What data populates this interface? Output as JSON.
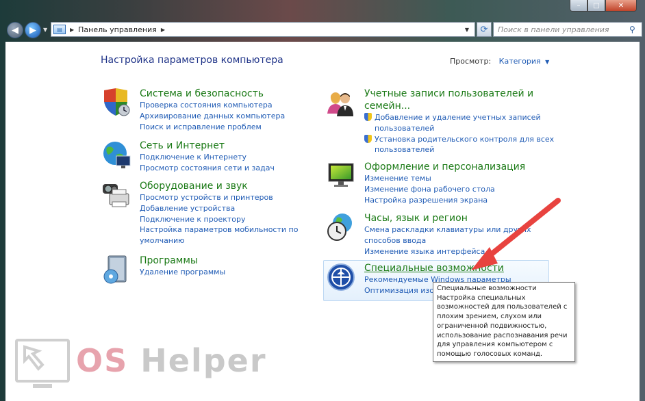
{
  "window": {
    "caption_buttons": [
      "–",
      "□",
      "✕"
    ]
  },
  "address_bar": {
    "path": "Панель управления"
  },
  "search": {
    "placeholder": "Поиск в панели управления"
  },
  "header": {
    "title": "Настройка параметров компьютера",
    "view_label": "Просмотр:",
    "view_value": "Категория"
  },
  "categories": [
    {
      "title": "Система и безопасность",
      "links": [
        "Проверка состояния компьютера",
        "Архивирование данных компьютера",
        "Поиск и исправление проблем"
      ]
    },
    {
      "title": "Сеть и Интернет",
      "links": [
        "Подключение к Интернету",
        "Просмотр состояния сети и задач"
      ]
    },
    {
      "title": "Оборудование и звук",
      "links": [
        "Просмотр устройств и принтеров",
        "Добавление устройства",
        "Подключение к проектору",
        "Настройка параметров мобильности по",
        "умолчанию"
      ]
    },
    {
      "title": "Программы",
      "links": [
        "Удаление программы"
      ]
    },
    {
      "title_lines": [
        "Учетные записи пользователей и",
        "семейн..."
      ],
      "links": [
        "Добавление и удаление учетных записей",
        "пользователей",
        "Установка родительского контроля для всех",
        "пользователей"
      ]
    },
    {
      "title": "Оформление и персонализация",
      "links": [
        "Изменение темы",
        "Изменение фона рабочего стола",
        "Настройка разрешения экрана"
      ]
    },
    {
      "title": "Часы, язык и регион",
      "links": [
        "Смена раскладки клавиатуры или других",
        "способов ввода",
        "Изменение языка интерфейса"
      ]
    },
    {
      "title": "Специальные возможности",
      "links": [
        "Рекомендуемые Windows параметры",
        "Оптимизация изоб"
      ]
    }
  ],
  "tooltip": {
    "lines": [
      "Специальные возможности",
      "Настройка специальных",
      "возможностей для пользователей с",
      "плохим зрением, слухом или",
      "ограниченной подвижностью,",
      "использование распознавания речи",
      "для управления компьютером с",
      "помощью голосовых команд."
    ]
  },
  "watermark": {
    "part1": "OS",
    "part2": "Helper"
  },
  "colors": {
    "category_title": "#1b7a16",
    "link": "#1e5ab4",
    "page_title": "#1e3287",
    "arrow": "#e8433f"
  }
}
